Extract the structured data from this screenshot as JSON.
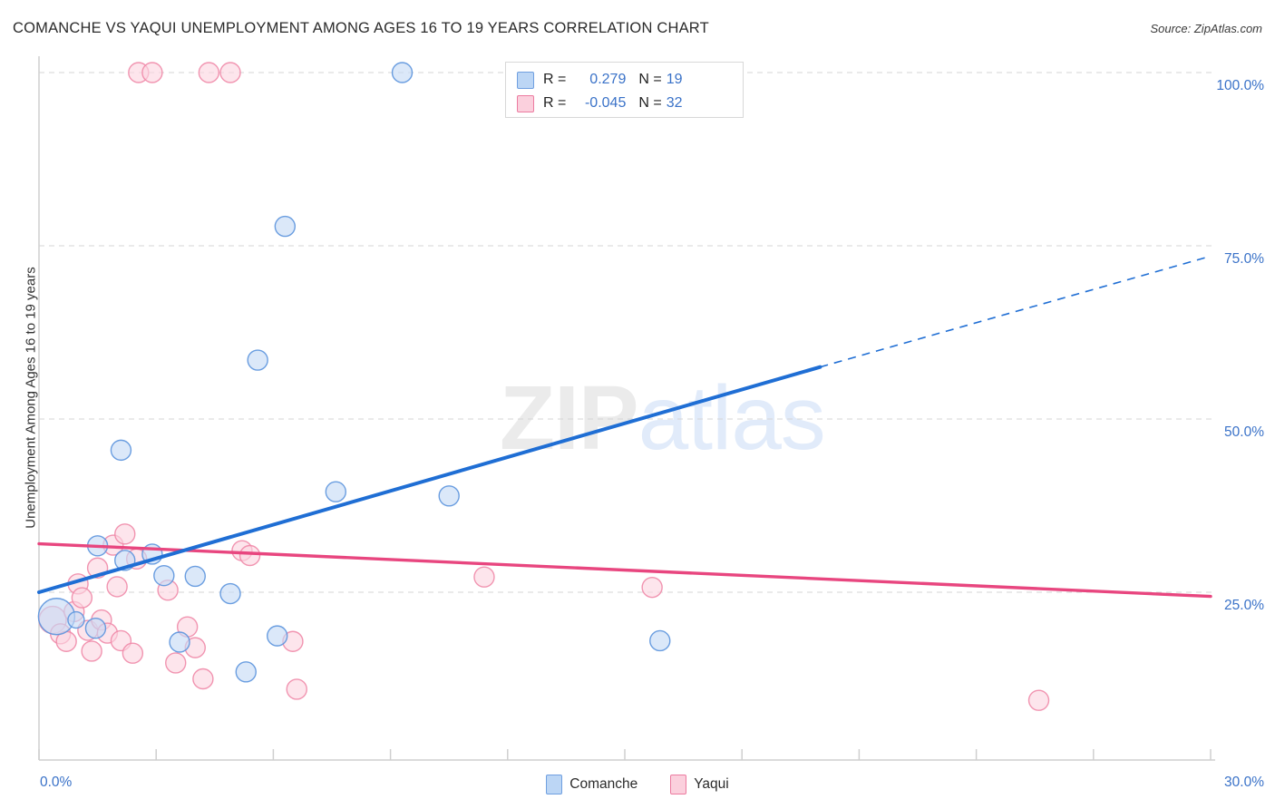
{
  "header": {
    "title": "COMANCHE VS YAQUI UNEMPLOYMENT AMONG AGES 16 TO 19 YEARS CORRELATION CHART",
    "source": "Source: ZipAtlas.com"
  },
  "watermark": {
    "part1": "ZIP",
    "part2": "atlas"
  },
  "axes": {
    "ylabel": "Unemployment Among Ages 16 to 19 years",
    "y_ticks": [
      "100.0%",
      "75.0%",
      "50.0%",
      "25.0%"
    ],
    "x_ticks": [
      "0.0%",
      "30.0%"
    ]
  },
  "legend": {
    "rows": [
      {
        "series": "Comanche",
        "r_label": "R =",
        "r_value": "0.279",
        "n_label": "N =",
        "n_value": "19",
        "color": "#bcd6f5"
      },
      {
        "series": "Yaqui",
        "r_label": "R =",
        "r_value": "-0.045",
        "n_label": "N =",
        "n_value": "32",
        "color": "#fbd0dd"
      }
    ]
  },
  "bottom_legend": {
    "items": [
      {
        "label": "Comanche",
        "color": "#bcd6f5",
        "border": "#6f9fe0"
      },
      {
        "label": "Yaqui",
        "color": "#fbd0dd",
        "border": "#ec7ba0"
      }
    ]
  },
  "colors": {
    "blue_fill": "#c5daf6",
    "blue_stroke": "#5b93dd",
    "pink_fill": "#fbd5e0",
    "pink_stroke": "#ef89a9",
    "blue_line": "#1f6ed4",
    "pink_line": "#e8467f",
    "tick_text": "#3a72c8",
    "grid": "#d5d5d5"
  },
  "chart_data": {
    "type": "scatter",
    "title": "COMANCHE VS YAQUI UNEMPLOYMENT AMONG AGES 16 TO 19 YEARS CORRELATION CHART",
    "xlabel": "",
    "ylabel": "Unemployment Among Ages 16 to 19 years",
    "xlim": [
      0,
      30
    ],
    "ylim": [
      7.5,
      103.5
    ],
    "x_unit": "%",
    "y_unit": "%",
    "grid": true,
    "gridlines_y": [
      25,
      50,
      75,
      100
    ],
    "legend_position": "bottom-center",
    "series": [
      {
        "name": "Comanche",
        "color": "#c5daf6",
        "r": 0.279,
        "n": 19,
        "trend": {
          "x0": 0,
          "y0": 25.0,
          "x1": 20.0,
          "y1": 57.5,
          "x_solid_end": 20.0,
          "x_dashed_end": 30.0,
          "y_dashed_end": 73.5
        },
        "points": [
          {
            "x": 0.45,
            "y": 21.5,
            "r": 20
          },
          {
            "x": 0.95,
            "y": 21.0,
            "r": 9
          },
          {
            "x": 1.45,
            "y": 19.8,
            "r": 11
          },
          {
            "x": 1.5,
            "y": 31.7,
            "r": 11
          },
          {
            "x": 2.1,
            "y": 45.5,
            "r": 11
          },
          {
            "x": 2.2,
            "y": 29.6,
            "r": 11
          },
          {
            "x": 2.9,
            "y": 30.5,
            "r": 11
          },
          {
            "x": 3.2,
            "y": 27.4,
            "r": 11
          },
          {
            "x": 3.6,
            "y": 17.8,
            "r": 11
          },
          {
            "x": 4.0,
            "y": 27.3,
            "r": 11
          },
          {
            "x": 4.9,
            "y": 24.8,
            "r": 11
          },
          {
            "x": 5.3,
            "y": 13.5,
            "r": 11
          },
          {
            "x": 5.6,
            "y": 58.5,
            "r": 11
          },
          {
            "x": 6.1,
            "y": 18.7,
            "r": 11
          },
          {
            "x": 6.3,
            "y": 77.8,
            "r": 11
          },
          {
            "x": 7.6,
            "y": 39.5,
            "r": 11
          },
          {
            "x": 9.3,
            "y": 100.0,
            "r": 11
          },
          {
            "x": 10.5,
            "y": 38.9,
            "r": 11
          },
          {
            "x": 15.9,
            "y": 18.0,
            "r": 11
          }
        ]
      },
      {
        "name": "Yaqui",
        "color": "#fbd5e0",
        "r": -0.045,
        "n": 32,
        "trend": {
          "x0": 0,
          "y0": 32.0,
          "x1": 30.0,
          "y1": 24.4,
          "x_solid_end": 30.0
        },
        "points": [
          {
            "x": 0.35,
            "y": 21.0,
            "r": 15
          },
          {
            "x": 0.55,
            "y": 19.0,
            "r": 11
          },
          {
            "x": 0.7,
            "y": 17.9,
            "r": 11
          },
          {
            "x": 0.9,
            "y": 22.2,
            "r": 11
          },
          {
            "x": 1.0,
            "y": 26.2,
            "r": 11
          },
          {
            "x": 1.1,
            "y": 24.2,
            "r": 11
          },
          {
            "x": 1.25,
            "y": 19.5,
            "r": 11
          },
          {
            "x": 1.35,
            "y": 16.5,
            "r": 11
          },
          {
            "x": 1.5,
            "y": 28.5,
            "r": 11
          },
          {
            "x": 1.6,
            "y": 21.0,
            "r": 11
          },
          {
            "x": 1.75,
            "y": 19.1,
            "r": 11
          },
          {
            "x": 1.9,
            "y": 31.8,
            "r": 11
          },
          {
            "x": 2.0,
            "y": 25.8,
            "r": 11
          },
          {
            "x": 2.1,
            "y": 18.0,
            "r": 11
          },
          {
            "x": 2.2,
            "y": 33.4,
            "r": 11
          },
          {
            "x": 2.4,
            "y": 16.2,
            "r": 11
          },
          {
            "x": 2.5,
            "y": 29.8,
            "r": 11
          },
          {
            "x": 2.55,
            "y": 100.0,
            "r": 11
          },
          {
            "x": 2.9,
            "y": 100.0,
            "r": 11
          },
          {
            "x": 3.3,
            "y": 25.3,
            "r": 11
          },
          {
            "x": 3.5,
            "y": 14.8,
            "r": 11
          },
          {
            "x": 3.8,
            "y": 20.0,
            "r": 11
          },
          {
            "x": 4.0,
            "y": 17.0,
            "r": 11
          },
          {
            "x": 4.2,
            "y": 12.5,
            "r": 11
          },
          {
            "x": 4.35,
            "y": 100.0,
            "r": 11
          },
          {
            "x": 4.9,
            "y": 100.0,
            "r": 11
          },
          {
            "x": 5.2,
            "y": 31.0,
            "r": 11
          },
          {
            "x": 5.4,
            "y": 30.3,
            "r": 11
          },
          {
            "x": 6.5,
            "y": 17.9,
            "r": 11
          },
          {
            "x": 6.6,
            "y": 11.0,
            "r": 11
          },
          {
            "x": 11.4,
            "y": 27.2,
            "r": 11
          },
          {
            "x": 15.7,
            "y": 25.7,
            "r": 11
          },
          {
            "x": 25.6,
            "y": 9.4,
            "r": 11
          }
        ]
      }
    ]
  }
}
